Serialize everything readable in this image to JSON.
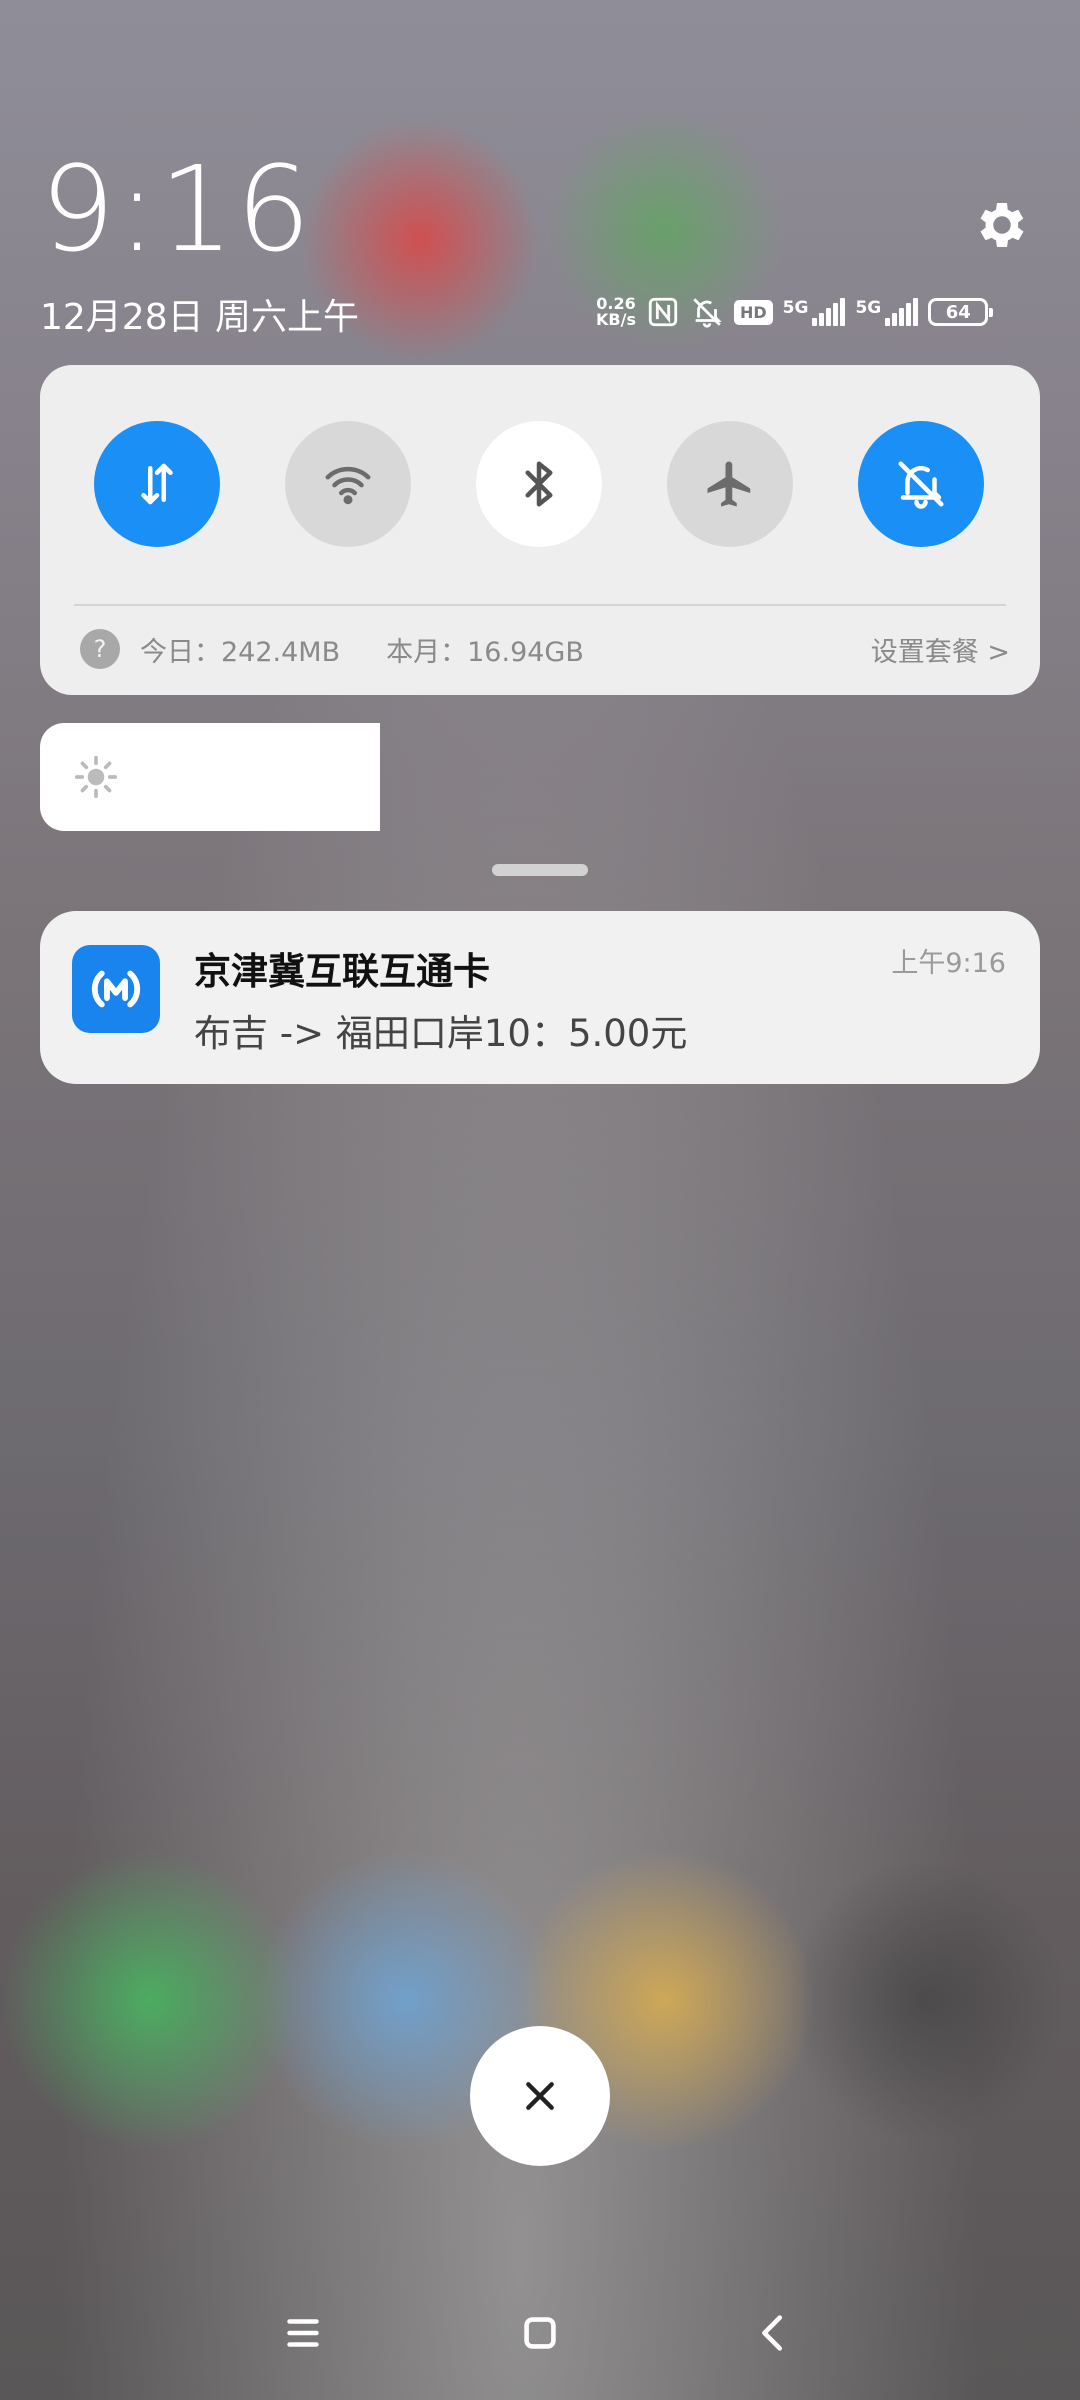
{
  "status": {
    "time": "9:16",
    "date": "12月28日 周六上午",
    "net_speed_value": "0.26",
    "net_speed_unit": "KB/s",
    "hd_label": "HD",
    "sim1_label": "5G",
    "sim2_label": "5G",
    "battery_level": "64"
  },
  "quick_settings": {
    "tiles": [
      {
        "name": "mobile-data",
        "icon": "data-transfer-icon",
        "state": "on"
      },
      {
        "name": "wifi",
        "icon": "wifi-icon",
        "state": "off"
      },
      {
        "name": "bluetooth",
        "icon": "bluetooth-icon",
        "state": "white"
      },
      {
        "name": "airplane-mode",
        "icon": "airplane-icon",
        "state": "off"
      },
      {
        "name": "silent-mode",
        "icon": "bell-off-icon",
        "state": "on"
      }
    ],
    "help_glyph": "?",
    "usage_today": "今日：242.4MB",
    "usage_month": "本月：16.94GB",
    "plan_link": "设置套餐 >"
  },
  "brightness": {
    "level_percent": 34
  },
  "notification": {
    "app_name": "京津冀互联互通卡",
    "body": "布吉 -> 福田口岸10：5.00元",
    "time": "上午9:16"
  },
  "colors": {
    "accent": "#1a8ff5",
    "app_icon_bg": "#1a84ee",
    "panel_bg": "#eeeeee"
  }
}
